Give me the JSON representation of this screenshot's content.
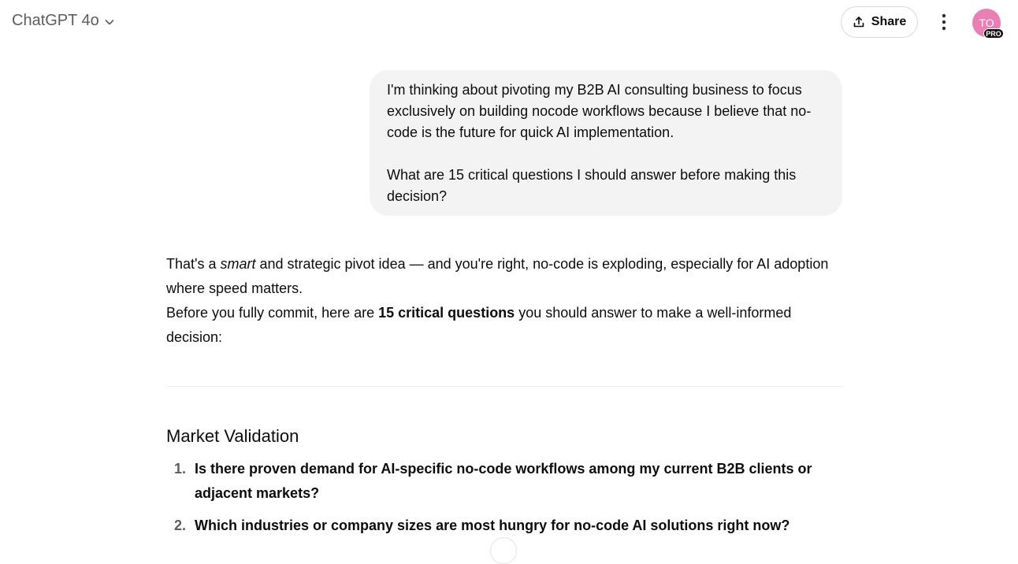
{
  "header": {
    "model_name": "ChatGPT 4o",
    "share_label": "Share",
    "avatar_initials": "TO",
    "pro_badge": "PRO"
  },
  "user_message": {
    "paragraph_1": "I'm thinking about pivoting my B2B AI consulting business to focus exclusively on building nocode workflows because I believe that no-code is the future for quick AI implementation.",
    "paragraph_2": "What are 15 critical questions I should answer before making this decision?"
  },
  "assistant_message": {
    "intro_part_1": "That's a ",
    "intro_emphasis": "smart",
    "intro_part_2": " and strategic pivot idea — and you're right, no-code is exploding, especially for AI adoption where speed matters.",
    "lead_part_1": "Before you fully commit, here are ",
    "lead_bold": "15 critical questions",
    "lead_part_2": " you should answer to make a well-informed decision:",
    "section_heading": "Market Validation",
    "questions": [
      {
        "number": "1.",
        "text": "Is there proven demand for AI-specific no-code workflows among my current B2B clients or adjacent markets?"
      },
      {
        "number": "2.",
        "text": "Which industries or company sizes are most hungry for no-code AI solutions right now?"
      }
    ]
  },
  "colors": {
    "avatar_bg": "#e97fb5",
    "bubble_bg": "#f3f3f3",
    "muted_text": "#5d5d5d"
  }
}
